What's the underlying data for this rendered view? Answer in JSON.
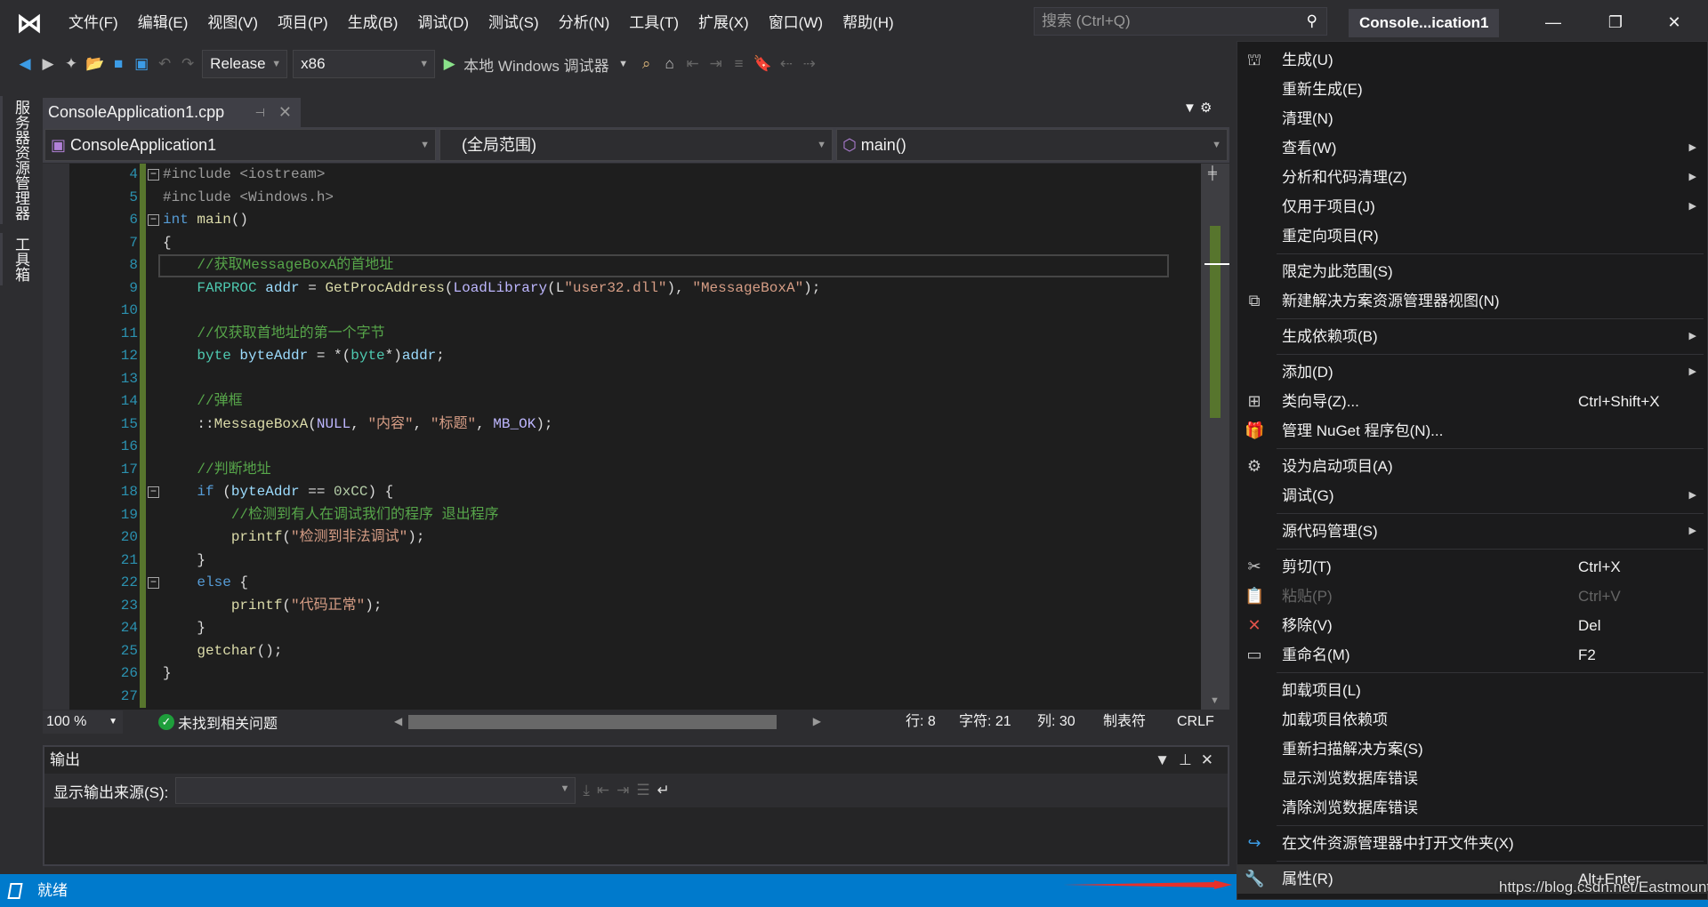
{
  "menubar": {
    "items": [
      "文件(F)",
      "编辑(E)",
      "视图(V)",
      "项目(P)",
      "生成(B)",
      "调试(D)",
      "测试(S)",
      "分析(N)",
      "工具(T)",
      "扩展(X)",
      "窗口(W)",
      "帮助(H)"
    ],
    "search_placeholder": "搜索 (Ctrl+Q)",
    "window_title": "Console...ication1"
  },
  "toolbar": {
    "configuration": "Release",
    "platform": "x86",
    "run_label": "本地 Windows 调试器"
  },
  "left_tabs": [
    "服务器资源管理器",
    "工具箱"
  ],
  "doc_tab": {
    "label": "ConsoleApplication1.cpp"
  },
  "navbar": {
    "project": "ConsoleApplication1",
    "scope": "(全局范围)",
    "member": "main()"
  },
  "editor": {
    "current_line": 8,
    "lines": [
      {
        "n": "4",
        "fold": "-",
        "t": [
          [
            "#include <iostream>",
            "pp"
          ]
        ]
      },
      {
        "n": "5",
        "t": [
          [
            "#include <Windows.h>",
            "pp"
          ]
        ]
      },
      {
        "n": "6",
        "fold": "-",
        "t": [
          [
            "int",
            "kw"
          ],
          [
            " main",
            "fn"
          ],
          [
            "()",
            "df"
          ]
        ]
      },
      {
        "n": "7",
        "t": [
          [
            "{",
            "df"
          ]
        ]
      },
      {
        "n": "8",
        "t": [
          [
            "    //获取MessageBoxA的首地址",
            "cm"
          ]
        ]
      },
      {
        "n": "9",
        "t": [
          [
            "    ",
            "df"
          ],
          [
            "FARPROC",
            "ty"
          ],
          [
            " addr",
            "va"
          ],
          [
            " = ",
            "df"
          ],
          [
            "GetProcAddress",
            "fn"
          ],
          [
            "(",
            "df"
          ],
          [
            "LoadLibrary",
            "ma"
          ],
          [
            "(L",
            "df"
          ],
          [
            "\"user32.dll\"",
            "st"
          ],
          [
            "), ",
            "df"
          ],
          [
            "\"MessageBoxA\"",
            "st"
          ],
          [
            ");",
            "df"
          ]
        ]
      },
      {
        "n": "10",
        "t": []
      },
      {
        "n": "11",
        "t": [
          [
            "    //仅获取首地址的第一个字节",
            "cm"
          ]
        ]
      },
      {
        "n": "12",
        "t": [
          [
            "    ",
            "df"
          ],
          [
            "byte",
            "ty"
          ],
          [
            " byteAddr",
            "va"
          ],
          [
            " = *(",
            "df"
          ],
          [
            "byte",
            "ty"
          ],
          [
            "*)",
            "df"
          ],
          [
            "addr",
            "va"
          ],
          [
            ";",
            "df"
          ]
        ]
      },
      {
        "n": "13",
        "t": []
      },
      {
        "n": "14",
        "t": [
          [
            "    //弹框",
            "cm"
          ]
        ]
      },
      {
        "n": "15",
        "t": [
          [
            "    ::",
            "df"
          ],
          [
            "MessageBoxA",
            "fn"
          ],
          [
            "(",
            "df"
          ],
          [
            "NULL",
            "ma"
          ],
          [
            ", ",
            "df"
          ],
          [
            "\"内容\"",
            "st"
          ],
          [
            ", ",
            "df"
          ],
          [
            "\"标题\"",
            "st"
          ],
          [
            ", ",
            "df"
          ],
          [
            "MB_OK",
            "ma"
          ],
          [
            ");",
            "df"
          ]
        ]
      },
      {
        "n": "16",
        "t": []
      },
      {
        "n": "17",
        "t": [
          [
            "    //判断地址",
            "cm"
          ]
        ]
      },
      {
        "n": "18",
        "fold": "-",
        "t": [
          [
            "    ",
            "df"
          ],
          [
            "if",
            "kw"
          ],
          [
            " (",
            "df"
          ],
          [
            "byteAddr",
            "va"
          ],
          [
            " == ",
            "df"
          ],
          [
            "0xCC",
            "nu"
          ],
          [
            ") {",
            "df"
          ]
        ]
      },
      {
        "n": "19",
        "t": [
          [
            "        //检测到有人在调试我们的程序 退出程序",
            "cm"
          ]
        ]
      },
      {
        "n": "20",
        "t": [
          [
            "        ",
            "df"
          ],
          [
            "printf",
            "fn"
          ],
          [
            "(",
            "df"
          ],
          [
            "\"检测到非法调试\"",
            "st"
          ],
          [
            ");",
            "df"
          ]
        ]
      },
      {
        "n": "21",
        "t": [
          [
            "    }",
            "df"
          ]
        ]
      },
      {
        "n": "22",
        "fold": "-",
        "t": [
          [
            "    ",
            "df"
          ],
          [
            "else",
            "kw"
          ],
          [
            " {",
            "df"
          ]
        ]
      },
      {
        "n": "23",
        "t": [
          [
            "        ",
            "df"
          ],
          [
            "printf",
            "fn"
          ],
          [
            "(",
            "df"
          ],
          [
            "\"代码正常\"",
            "st"
          ],
          [
            ");",
            "df"
          ]
        ]
      },
      {
        "n": "24",
        "t": [
          [
            "    }",
            "df"
          ]
        ]
      },
      {
        "n": "25",
        "t": [
          [
            "    ",
            "df"
          ],
          [
            "getchar",
            "fn"
          ],
          [
            "();",
            "df"
          ]
        ]
      },
      {
        "n": "26",
        "t": [
          [
            "}",
            "df"
          ]
        ]
      },
      {
        "n": "27",
        "t": []
      }
    ]
  },
  "editor_bar": {
    "zoom": "100 %",
    "issues": "未找到相关问题",
    "line": "行: 8",
    "char": "字符: 21",
    "col": "列: 30",
    "tabs": "制表符",
    "eol": "CRLF"
  },
  "output": {
    "title": "输出",
    "source_label": "显示输出来源(S):"
  },
  "statusbar": {
    "text": "就绪"
  },
  "watermark": "https://blog.csdn.net/Eastmount",
  "context_menu": [
    {
      "label": "生成(U)",
      "icon": "build-icon"
    },
    {
      "label": "重新生成(E)"
    },
    {
      "label": "清理(N)"
    },
    {
      "label": "查看(W)",
      "submenu": true
    },
    {
      "label": "分析和代码清理(Z)",
      "submenu": true
    },
    {
      "label": "仅用于项目(J)",
      "submenu": true
    },
    {
      "label": "重定向项目(R)"
    },
    {
      "sep": true
    },
    {
      "label": "限定为此范围(S)"
    },
    {
      "label": "新建解决方案资源管理器视图(N)",
      "icon": "new-view-icon"
    },
    {
      "sep": true
    },
    {
      "label": "生成依赖项(B)",
      "submenu": true
    },
    {
      "sep": true
    },
    {
      "label": "添加(D)",
      "submenu": true
    },
    {
      "label": "类向导(Z)...",
      "shortcut": "Ctrl+Shift+X",
      "icon": "class-wizard-icon"
    },
    {
      "label": "管理 NuGet 程序包(N)...",
      "icon": "nuget-icon"
    },
    {
      "sep": true
    },
    {
      "label": "设为启动项目(A)",
      "icon": "gear-icon"
    },
    {
      "label": "调试(G)",
      "submenu": true
    },
    {
      "sep": true
    },
    {
      "label": "源代码管理(S)",
      "submenu": true
    },
    {
      "sep": true
    },
    {
      "label": "剪切(T)",
      "shortcut": "Ctrl+X",
      "icon": "scissors-icon"
    },
    {
      "label": "粘贴(P)",
      "shortcut": "Ctrl+V",
      "icon": "paste-icon",
      "disabled": true
    },
    {
      "label": "移除(V)",
      "shortcut": "Del",
      "icon": "remove-icon"
    },
    {
      "label": "重命名(M)",
      "shortcut": "F2",
      "icon": "rename-icon"
    },
    {
      "sep": true
    },
    {
      "label": "卸载项目(L)"
    },
    {
      "label": "加载项目依赖项"
    },
    {
      "label": "重新扫描解决方案(S)"
    },
    {
      "label": "显示浏览数据库错误"
    },
    {
      "label": "清除浏览数据库错误"
    },
    {
      "sep": true
    },
    {
      "label": "在文件资源管理器中打开文件夹(X)",
      "icon": "open-folder-arrow-icon"
    },
    {
      "sep": true
    },
    {
      "label": "属性(R)",
      "shortcut": "Alt+Enter",
      "icon": "wrench-icon",
      "highlighted": true
    }
  ],
  "colors": {
    "accent": "#007acc",
    "remove_icon": "#e0524a",
    "open_folder_icon": "#3c9ce6",
    "change_bar": "#57752d"
  }
}
